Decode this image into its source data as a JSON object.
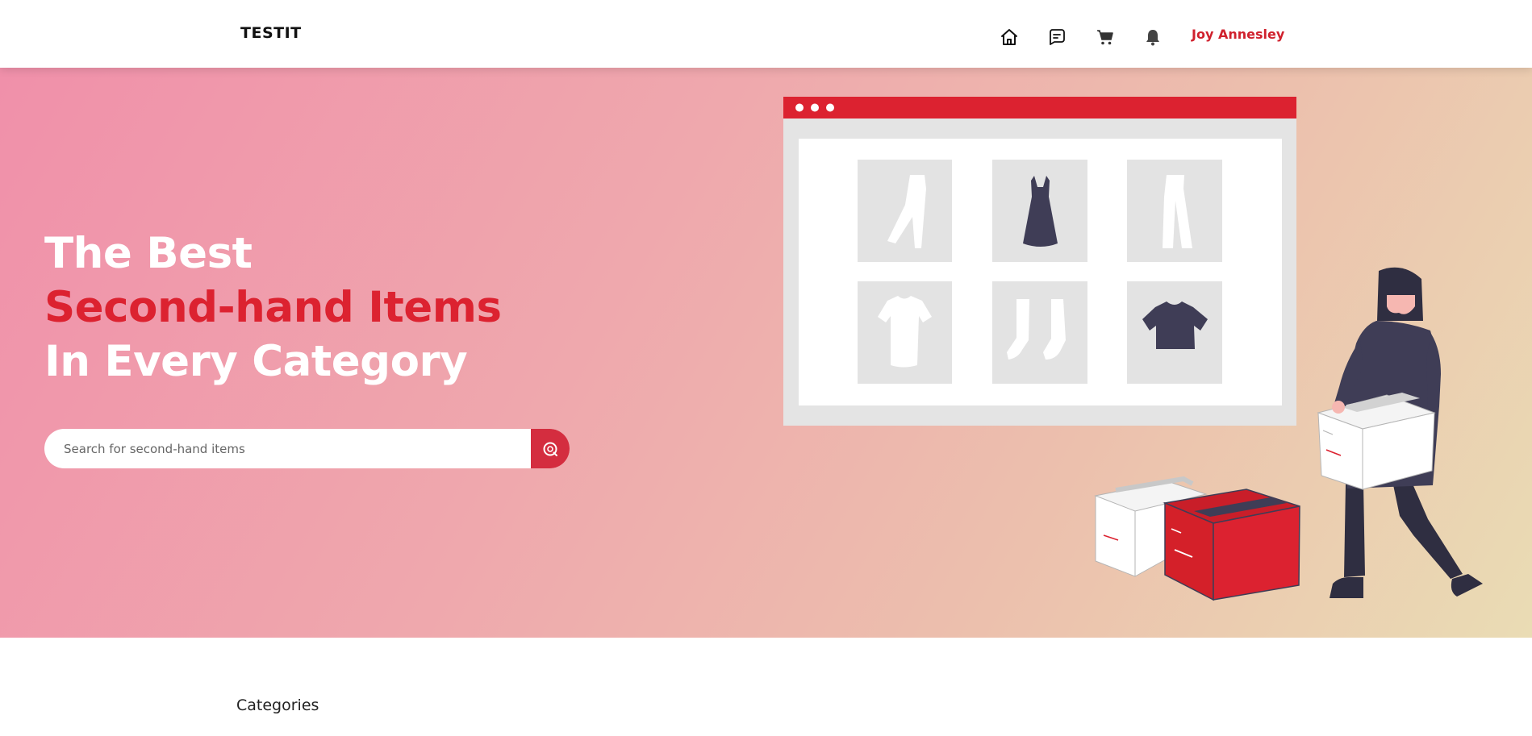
{
  "header": {
    "brand": "TESTIT",
    "nav_icons": [
      "home-icon",
      "message-icon",
      "cart-icon",
      "bell-icon"
    ],
    "user_name": "Joy Annesley"
  },
  "hero": {
    "headline_line1": "The Best",
    "headline_line2": "Second-hand Items",
    "headline_line3": "In Every Category",
    "search_placeholder": "Search for second-hand items",
    "search_icon": "search-icon",
    "illustration": "online-shop-delivery-illustration"
  },
  "categories": {
    "title": "Categories"
  },
  "colors": {
    "accent_red": "#dc2230",
    "dark_figure": "#3f3d56",
    "panel_gray": "#e4e4e4",
    "hero_gradient_start": "#f090aa",
    "hero_gradient_end": "#eadcb4"
  }
}
